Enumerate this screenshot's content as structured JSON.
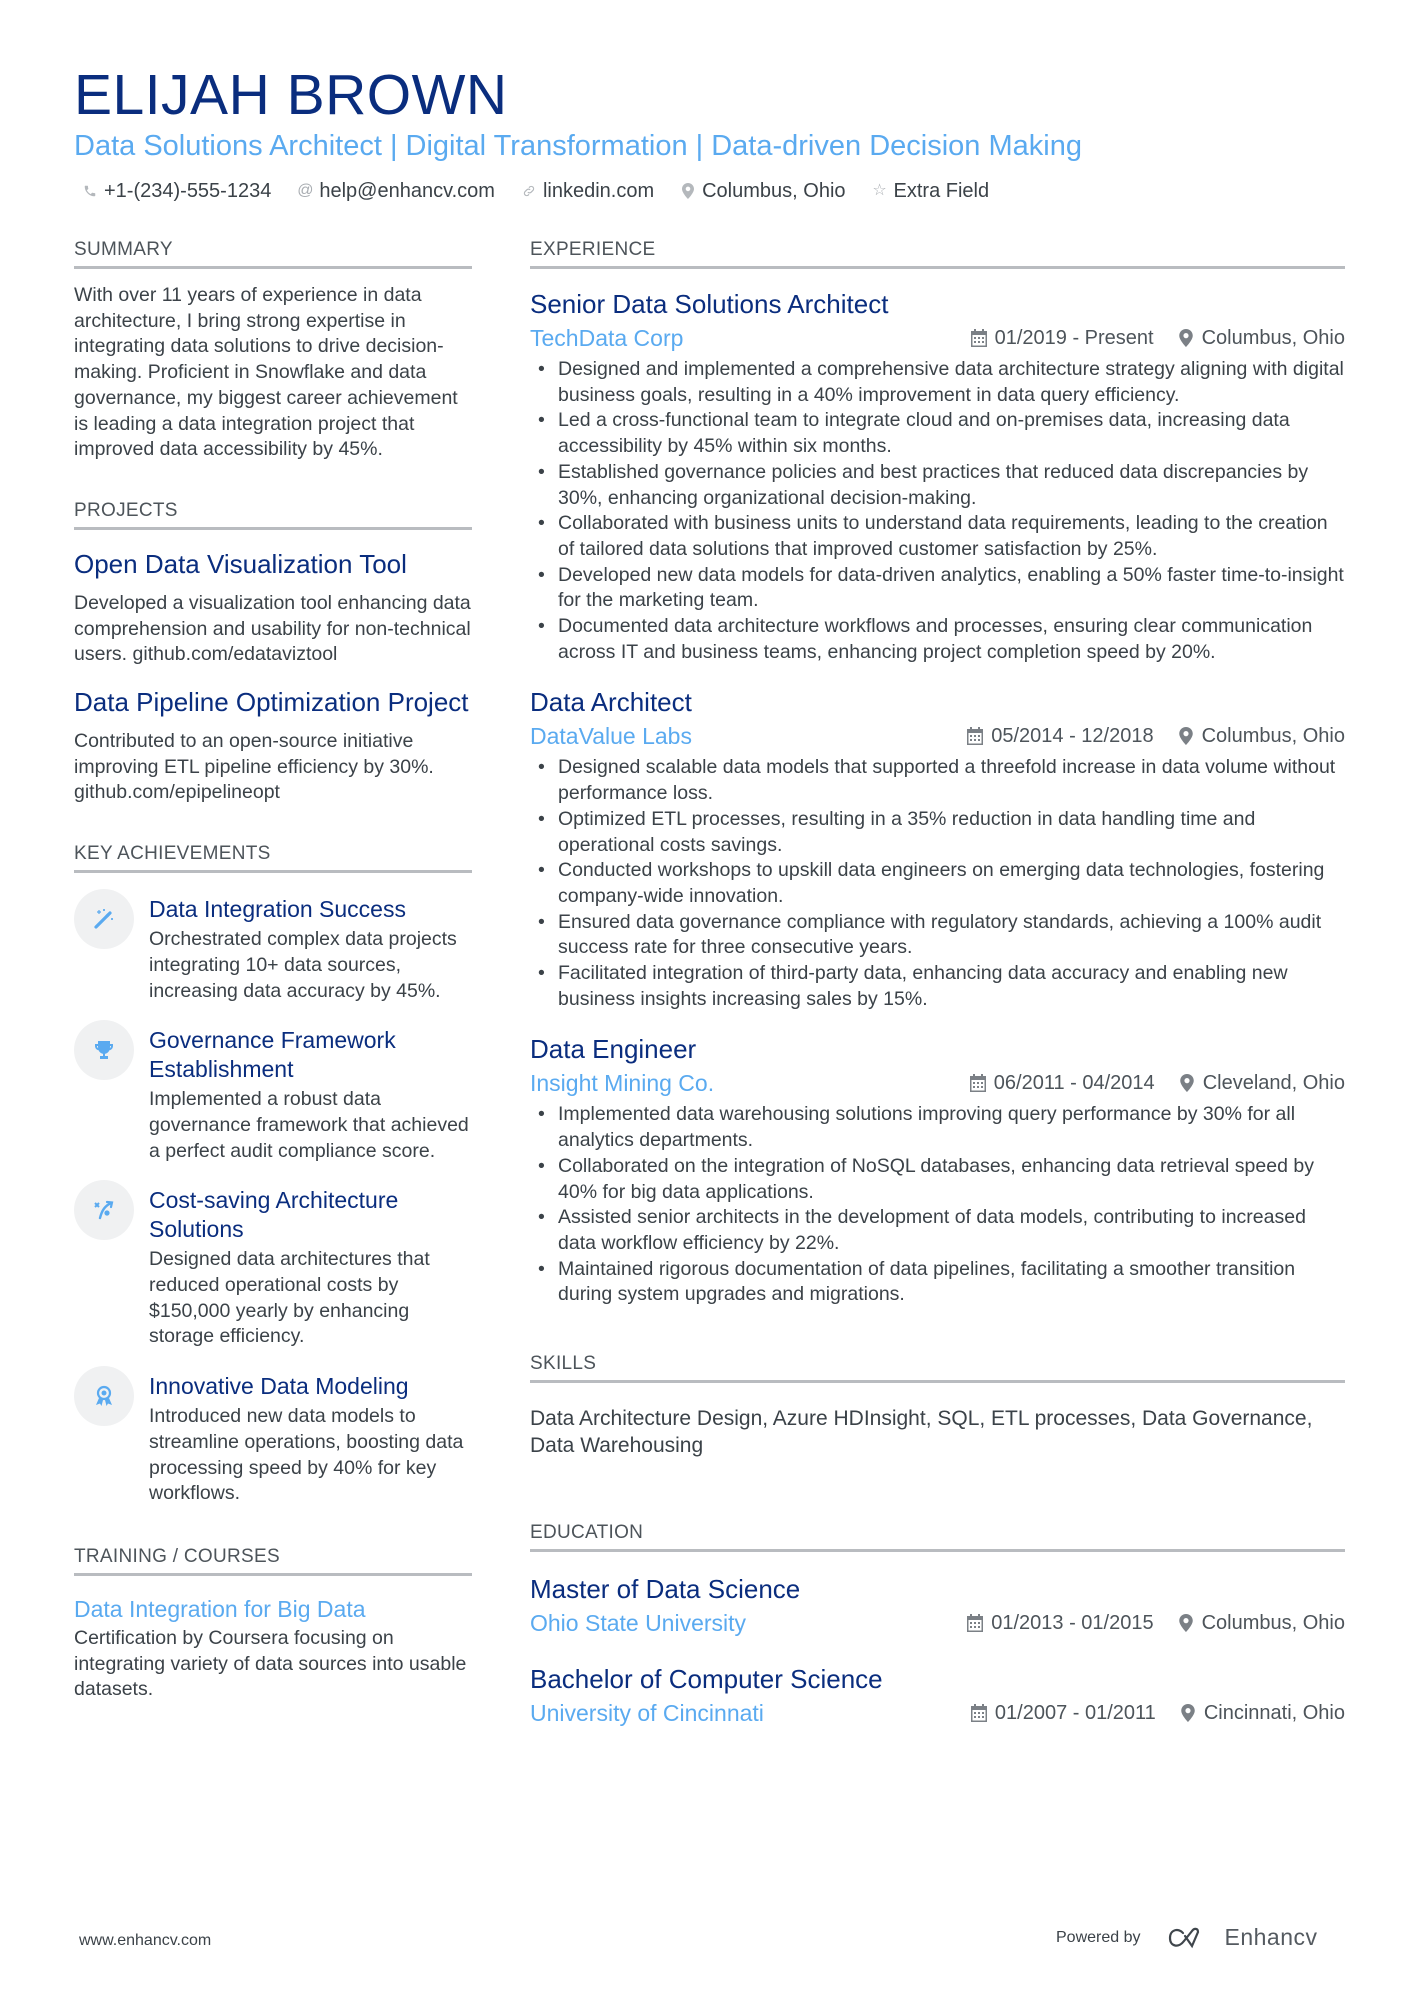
{
  "header": {
    "name": "ELIJAH BROWN",
    "subtitle": "Data Solutions Architect | Digital Transformation | Data-driven Decision Making",
    "contacts": [
      {
        "icon": "phone-icon",
        "text": "+1-(234)-555-1234"
      },
      {
        "icon": "at-icon",
        "text": "help@enhancv.com"
      },
      {
        "icon": "link-icon",
        "text": "linkedin.com"
      },
      {
        "icon": "location-icon",
        "text": "Columbus, Ohio"
      },
      {
        "icon": "star-icon",
        "text": "Extra Field"
      }
    ]
  },
  "summary": {
    "title": "SUMMARY",
    "text": "With over 11 years of experience in data architecture, I bring strong expertise in integrating data solutions to drive decision-making. Proficient in Snowflake and data governance, my biggest career achievement is leading a data integration project that improved data accessibility by 45%."
  },
  "projects": {
    "title": "PROJECTS",
    "items": [
      {
        "title": "Open Data Visualization Tool",
        "description": "Developed a visualization tool enhancing data comprehension and usability for non-technical users. github.com/edataviztool"
      },
      {
        "title": "Data Pipeline Optimization Project",
        "description": "Contributed to an open-source initiative improving ETL pipeline efficiency by 30%. github.com/epipelineopt"
      }
    ]
  },
  "achievements": {
    "title": "KEY ACHIEVEMENTS",
    "items": [
      {
        "icon": "magic-wand-icon",
        "title": "Data Integration Success",
        "description": "Orchestrated complex data projects integrating 10+ data sources, increasing data accuracy by 45%."
      },
      {
        "icon": "trophy-icon",
        "title": "Governance Framework Establishment",
        "description": "Implemented a robust data governance framework that achieved a perfect audit compliance score."
      },
      {
        "icon": "route-icon",
        "title": "Cost-saving Architecture Solutions",
        "description": "Designed data architectures that reduced operational costs by $150,000 yearly by enhancing storage efficiency."
      },
      {
        "icon": "award-medal-icon",
        "title": "Innovative Data Modeling",
        "description": "Introduced new data models to streamline operations, boosting data processing speed by 40% for key workflows."
      }
    ]
  },
  "training": {
    "title": "TRAINING / COURSES",
    "items": [
      {
        "title": "Data Integration for Big Data",
        "description": "Certification by Coursera focusing on integrating variety of data sources into usable datasets."
      }
    ]
  },
  "experience": {
    "title": "EXPERIENCE",
    "jobs": [
      {
        "title": "Senior Data Solutions Architect",
        "company": "TechData Corp",
        "dates": "01/2019 - Present",
        "location": "Columbus, Ohio",
        "bullets": [
          "Designed and implemented a comprehensive data architecture strategy aligning with digital business goals, resulting in a 40% improvement in data query efficiency.",
          "Led a cross-functional team to integrate cloud and on-premises data, increasing data accessibility by 45% within six months.",
          "Established governance policies and best practices that reduced data discrepancies by 30%, enhancing organizational decision-making.",
          "Collaborated with business units to understand data requirements, leading to the creation of tailored data solutions that improved customer satisfaction by 25%.",
          "Developed new data models for data-driven analytics, enabling a 50% faster time-to-insight for the marketing team.",
          "Documented data architecture workflows and processes, ensuring clear communication across IT and business teams, enhancing project completion speed by 20%."
        ]
      },
      {
        "title": "Data Architect",
        "company": "DataValue Labs",
        "dates": "05/2014 - 12/2018",
        "location": "Columbus, Ohio",
        "bullets": [
          "Designed scalable data models that supported a threefold increase in data volume without performance loss.",
          "Optimized ETL processes, resulting in a 35% reduction in data handling time and operational costs savings.",
          "Conducted workshops to upskill data engineers on emerging data technologies, fostering company-wide innovation.",
          "Ensured data governance compliance with regulatory standards, achieving a 100% audit success rate for three consecutive years.",
          "Facilitated integration of third-party data, enhancing data accuracy and enabling new business insights increasing sales by 15%."
        ]
      },
      {
        "title": "Data Engineer",
        "company": "Insight Mining Co.",
        "dates": "06/2011 - 04/2014",
        "location": "Cleveland, Ohio",
        "bullets": [
          "Implemented data warehousing solutions improving query performance by 30% for all analytics departments.",
          "Collaborated on the integration of NoSQL databases, enhancing data retrieval speed by 40% for big data applications.",
          "Assisted senior architects in the development of data models, contributing to increased data workflow efficiency by 22%.",
          "Maintained rigorous documentation of data pipelines, facilitating a smoother transition during system upgrades and migrations."
        ]
      }
    ]
  },
  "skills": {
    "title": "SKILLS",
    "text": "Data Architecture Design, Azure HDInsight, SQL, ETL processes, Data Governance, Data Warehousing"
  },
  "education": {
    "title": "EDUCATION",
    "items": [
      {
        "degree": "Master of Data Science",
        "school": "Ohio State University",
        "dates": "01/2013 - 01/2015",
        "location": "Columbus, Ohio"
      },
      {
        "degree": "Bachelor of Computer Science",
        "school": "University of Cincinnati",
        "dates": "01/2007 - 01/2011",
        "location": "Cincinnati, Ohio"
      }
    ]
  },
  "footer": {
    "website": "www.enhancv.com",
    "powered_by": "Powered by",
    "brand": "Enhancv"
  },
  "colors": {
    "name": "#0a2d7e",
    "accent": "#5aaaf0",
    "text": "#3b4248",
    "divider": "#b9bcc0",
    "icon_bg": "#f0f1f2"
  }
}
